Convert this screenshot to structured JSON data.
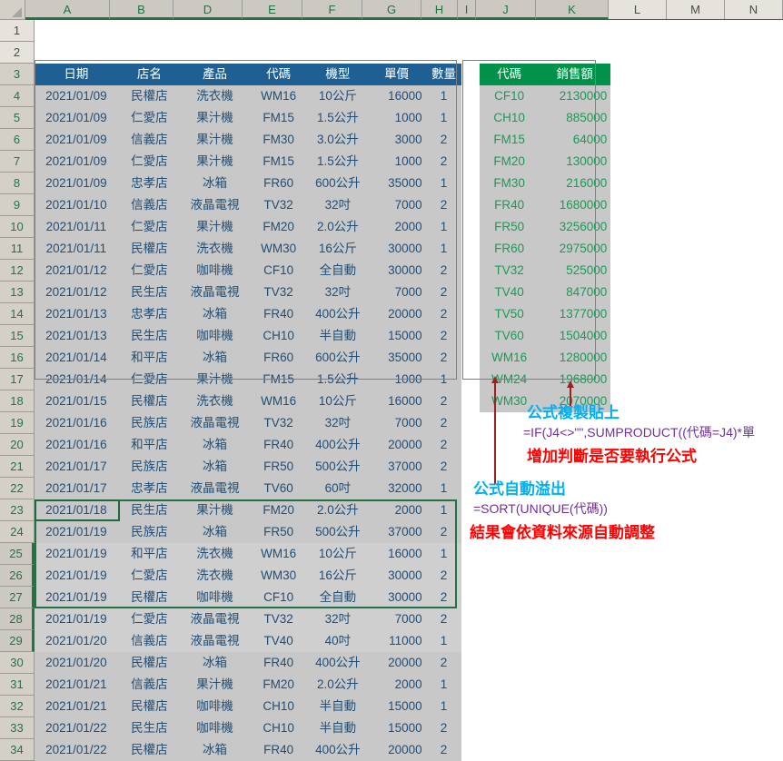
{
  "app": {
    "type": "spreadsheet"
  },
  "columns": [
    {
      "label": "A",
      "width": 93,
      "selected": true
    },
    {
      "label": "B",
      "width": 70,
      "selected": true
    },
    {
      "label": "D",
      "width": 76,
      "selected": true
    },
    {
      "label": "E",
      "width": 66,
      "selected": true
    },
    {
      "label": "F",
      "width": 66,
      "selected": true
    },
    {
      "label": "G",
      "width": 65,
      "selected": true
    },
    {
      "label": "H",
      "width": 40,
      "selected": true
    },
    {
      "label": "I",
      "width": 20,
      "selected": true
    },
    {
      "label": "J",
      "width": 66,
      "selected": true
    },
    {
      "label": "K",
      "width": 80,
      "selected": true
    },
    {
      "label": "L",
      "width": 64,
      "selected": false
    },
    {
      "label": "M",
      "width": 64,
      "selected": false
    },
    {
      "label": "N",
      "width": 64,
      "selected": false
    }
  ],
  "rows": [
    "1",
    "2",
    "3",
    "4",
    "5",
    "6",
    "7",
    "8",
    "9",
    "10",
    "11",
    "12",
    "13",
    "14",
    "15",
    "16",
    "17",
    "18",
    "19",
    "20",
    "21",
    "22",
    "23",
    "24",
    "25",
    "26",
    "27",
    "28",
    "29",
    "30",
    "31",
    "32",
    "33",
    "34"
  ],
  "sales_table": {
    "headers": [
      "日期",
      "店名",
      "產品",
      "代碼",
      "機型",
      "單價",
      "數量"
    ],
    "rows": [
      [
        "2021/01/09",
        "民權店",
        "洗衣機",
        "WM16",
        "10公斤",
        "16000",
        "1"
      ],
      [
        "2021/01/09",
        "仁愛店",
        "果汁機",
        "FM15",
        "1.5公升",
        "1000",
        "1"
      ],
      [
        "2021/01/09",
        "信義店",
        "果汁機",
        "FM30",
        "3.0公升",
        "3000",
        "2"
      ],
      [
        "2021/01/09",
        "仁愛店",
        "果汁機",
        "FM15",
        "1.5公升",
        "1000",
        "2"
      ],
      [
        "2021/01/09",
        "忠孝店",
        "冰箱",
        "FR60",
        "600公升",
        "35000",
        "1"
      ],
      [
        "2021/01/10",
        "信義店",
        "液晶電視",
        "TV32",
        "32吋",
        "7000",
        "2"
      ],
      [
        "2021/01/11",
        "仁愛店",
        "果汁機",
        "FM20",
        "2.0公升",
        "2000",
        "1"
      ],
      [
        "2021/01/11",
        "民權店",
        "洗衣機",
        "WM30",
        "16公斤",
        "30000",
        "1"
      ],
      [
        "2021/01/12",
        "仁愛店",
        "咖啡機",
        "CF10",
        "全自動",
        "30000",
        "2"
      ],
      [
        "2021/01/12",
        "民生店",
        "液晶電視",
        "TV32",
        "32吋",
        "7000",
        "2"
      ],
      [
        "2021/01/13",
        "忠孝店",
        "冰箱",
        "FR40",
        "400公升",
        "20000",
        "2"
      ],
      [
        "2021/01/13",
        "民生店",
        "咖啡機",
        "CH10",
        "半自動",
        "15000",
        "2"
      ],
      [
        "2021/01/14",
        "和平店",
        "冰箱",
        "FR60",
        "600公升",
        "35000",
        "2"
      ],
      [
        "2021/01/14",
        "仁愛店",
        "果汁機",
        "FM15",
        "1.5公升",
        "1000",
        "1"
      ],
      [
        "2021/01/15",
        "民權店",
        "洗衣機",
        "WM16",
        "10公斤",
        "16000",
        "2"
      ],
      [
        "2021/01/16",
        "民族店",
        "液晶電視",
        "TV32",
        "32吋",
        "7000",
        "2"
      ],
      [
        "2021/01/16",
        "和平店",
        "冰箱",
        "FR40",
        "400公升",
        "20000",
        "2"
      ],
      [
        "2021/01/17",
        "民族店",
        "冰箱",
        "FR50",
        "500公升",
        "37000",
        "2"
      ],
      [
        "2021/01/17",
        "忠孝店",
        "液晶電視",
        "TV60",
        "60吋",
        "32000",
        "1"
      ],
      [
        "2021/01/18",
        "民生店",
        "果汁機",
        "FM20",
        "2.0公升",
        "2000",
        "1"
      ],
      [
        "2021/01/19",
        "民族店",
        "冰箱",
        "FR50",
        "500公升",
        "37000",
        "2"
      ],
      [
        "2021/01/19",
        "和平店",
        "洗衣機",
        "WM16",
        "10公斤",
        "16000",
        "1"
      ],
      [
        "2021/01/19",
        "仁愛店",
        "洗衣機",
        "WM30",
        "16公斤",
        "30000",
        "2"
      ],
      [
        "2021/01/19",
        "民權店",
        "咖啡機",
        "CF10",
        "全自動",
        "30000",
        "2"
      ],
      [
        "2021/01/19",
        "仁愛店",
        "液晶電視",
        "TV32",
        "32吋",
        "7000",
        "2"
      ],
      [
        "2021/01/20",
        "信義店",
        "液晶電視",
        "TV40",
        "40吋",
        "11000",
        "1"
      ],
      [
        "2021/01/20",
        "民權店",
        "冰箱",
        "FR40",
        "400公升",
        "20000",
        "2"
      ],
      [
        "2021/01/21",
        "信義店",
        "果汁機",
        "FM20",
        "2.0公升",
        "2000",
        "1"
      ],
      [
        "2021/01/21",
        "民權店",
        "咖啡機",
        "CH10",
        "半自動",
        "15000",
        "1"
      ],
      [
        "2021/01/22",
        "民生店",
        "咖啡機",
        "CH10",
        "半自動",
        "15000",
        "2"
      ],
      [
        "2021/01/22",
        "民權店",
        "冰箱",
        "FR40",
        "400公升",
        "20000",
        "2"
      ]
    ]
  },
  "summary_table": {
    "headers": [
      "代碼",
      "銷售額"
    ],
    "rows": [
      [
        "CF10",
        "2130000"
      ],
      [
        "CH10",
        "885000"
      ],
      [
        "FM15",
        "64000"
      ],
      [
        "FM20",
        "130000"
      ],
      [
        "FM30",
        "216000"
      ],
      [
        "FR40",
        "1680000"
      ],
      [
        "FR50",
        "3256000"
      ],
      [
        "FR60",
        "2975000"
      ],
      [
        "TV32",
        "525000"
      ],
      [
        "TV40",
        "847000"
      ],
      [
        "TV50",
        "1377000"
      ],
      [
        "TV60",
        "1504000"
      ],
      [
        "WM16",
        "1280000"
      ],
      [
        "WM24",
        "1968000"
      ],
      [
        "WM30",
        "2070000"
      ]
    ]
  },
  "annotations": [
    {
      "id": "copy-paste-formula",
      "title": "公式複製貼上",
      "formula": "=IF(J4<>\"\",SUMPRODUCT((代碼=J4)*單",
      "note": "增加判斷是否要執行公式"
    },
    {
      "id": "spill-formula",
      "title": "公式自動溢出",
      "formula": "=SORT(UNIQUE(代碼))",
      "note": "結果會依資料來源自動調整"
    }
  ],
  "colors": {
    "blue_header": "#1f6094",
    "green_header": "#00914a",
    "anno_title": "#00b0f0",
    "anno_formula": "#7030a0",
    "anno_note": "#ff0000",
    "arrow": "#9e2020",
    "selection": "#217346"
  }
}
